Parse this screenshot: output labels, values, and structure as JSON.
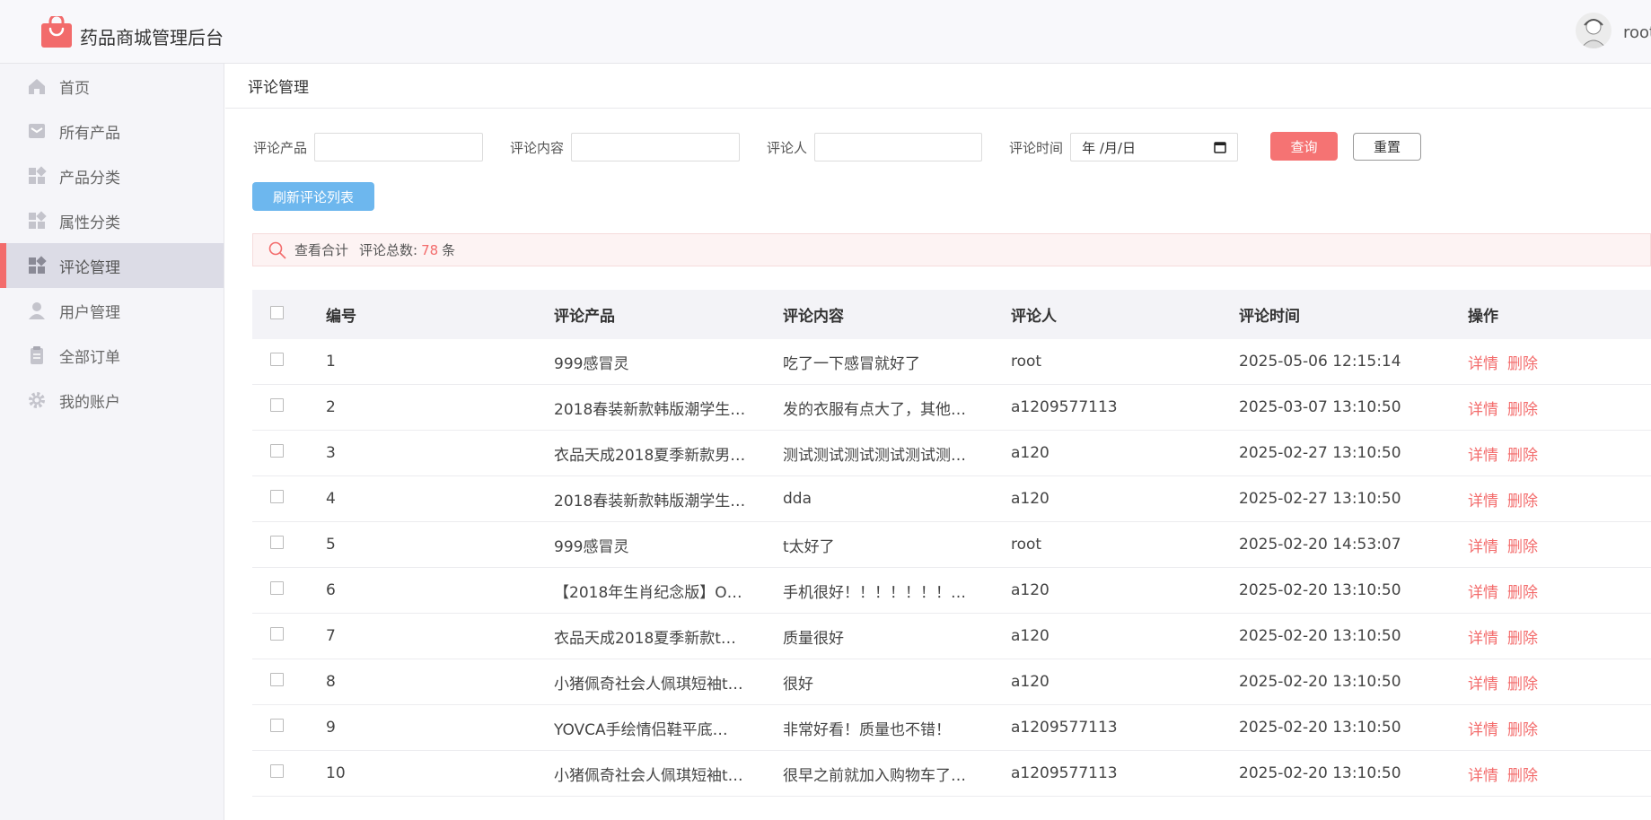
{
  "app": {
    "title": "药品商城管理后台",
    "username": "root",
    "logo_icon": "shopping-bag-icon",
    "brand_color": "#f36c6c"
  },
  "sidebar": {
    "items": [
      {
        "label": "首页",
        "icon": "home-icon"
      },
      {
        "label": "所有产品",
        "icon": "inbox-icon"
      },
      {
        "label": "产品分类",
        "icon": "grid-icon"
      },
      {
        "label": "属性分类",
        "icon": "grid-icon"
      },
      {
        "label": "评论管理",
        "icon": "grid-icon",
        "active": true
      },
      {
        "label": "用户管理",
        "icon": "user-icon"
      },
      {
        "label": "全部订单",
        "icon": "clipboard-icon"
      },
      {
        "label": "我的账户",
        "icon": "gear-icon"
      }
    ]
  },
  "page": {
    "title": "评论管理"
  },
  "filters": {
    "product_label": "评论产品",
    "content_label": "评论内容",
    "user_label": "评论人",
    "time_label": "评论时间",
    "date_placeholder": "年 /月/日",
    "query_button": "查询",
    "reset_button": "重置",
    "refresh_button": "刷新评论列表"
  },
  "summary": {
    "view_total": "查看合计",
    "total_label": "评论总数:",
    "total_count": "78",
    "unit": "条"
  },
  "table": {
    "headers": {
      "id": "编号",
      "product": "评论产品",
      "content": "评论内容",
      "user": "评论人",
      "time": "评论时间",
      "ops": "操作"
    },
    "detail_label": "详情",
    "delete_label": "删除",
    "rows": [
      {
        "id": "1",
        "product": "999感冒灵",
        "content": "吃了一下感冒就好了",
        "user": "root",
        "time": "2025-05-06 12:15:14"
      },
      {
        "id": "2",
        "product": "2018春装新款韩版潮学生…",
        "content": "发的衣服有点大了，其他…",
        "user": "a1209577113",
        "time": "2025-03-07 13:10:50"
      },
      {
        "id": "3",
        "product": "衣品天成2018夏季新款男…",
        "content": "测试测试测试测试测试测…",
        "user": "a120",
        "time": "2025-02-27 13:10:50"
      },
      {
        "id": "4",
        "product": "2018春装新款韩版潮学生…",
        "content": "dda",
        "user": "a120",
        "time": "2025-02-27 13:10:50"
      },
      {
        "id": "5",
        "product": "999感冒灵",
        "content": "t太好了",
        "user": "root",
        "time": "2025-02-20 14:53:07"
      },
      {
        "id": "6",
        "product": "【2018年生肖纪念版】O…",
        "content": "手机很好！！！！！！！…",
        "user": "a120",
        "time": "2025-02-20 13:10:50"
      },
      {
        "id": "7",
        "product": "衣品天成2018夏季新款t…",
        "content": "质量很好",
        "user": "a120",
        "time": "2025-02-20 13:10:50"
      },
      {
        "id": "8",
        "product": "小猪佩奇社会人佩琪短袖t…",
        "content": "很好",
        "user": "a120",
        "time": "2025-02-20 13:10:50"
      },
      {
        "id": "9",
        "product": "YOVCA手绘情侣鞋平底…",
        "content": "非常好看！质量也不错！",
        "user": "a1209577113",
        "time": "2025-02-20 13:10:50"
      },
      {
        "id": "10",
        "product": "小猪佩奇社会人佩琪短袖t…",
        "content": "很早之前就加入购物车了…",
        "user": "a1209577113",
        "time": "2025-02-20 13:10:50"
      }
    ]
  }
}
